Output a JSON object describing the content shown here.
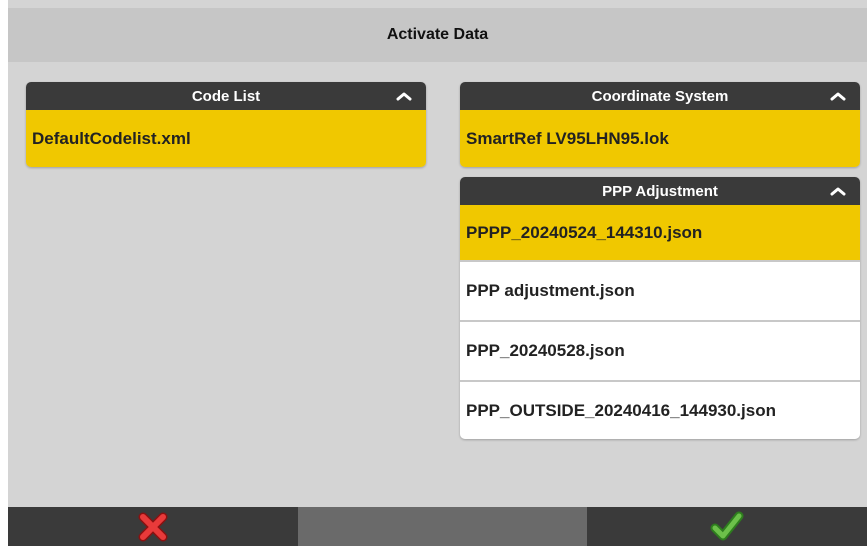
{
  "dialog": {
    "title": "Activate Data"
  },
  "code_list": {
    "header": "Code List",
    "items": [
      {
        "label": "DefaultCodelist.xml",
        "selected": true
      }
    ]
  },
  "coordinate_system": {
    "header": "Coordinate System",
    "items": [
      {
        "label": "SmartRef LV95LHN95.lok",
        "selected": true
      }
    ]
  },
  "ppp_adjustment": {
    "header": "PPP Adjustment",
    "items": [
      {
        "label": "PPPP_20240524_144310.json",
        "selected": true
      },
      {
        "label": "PPP adjustment.json",
        "selected": false
      },
      {
        "label": "PPP_20240528.json",
        "selected": false
      },
      {
        "label": "PPP_OUTSIDE_20240416_144930.json",
        "selected": false
      }
    ]
  },
  "footer": {
    "cancel_icon": "red-x-icon",
    "confirm_icon": "green-check-icon"
  },
  "colors": {
    "selected": "#f0c800",
    "header": "#3a3a3a",
    "background": "#d4d4d4"
  }
}
